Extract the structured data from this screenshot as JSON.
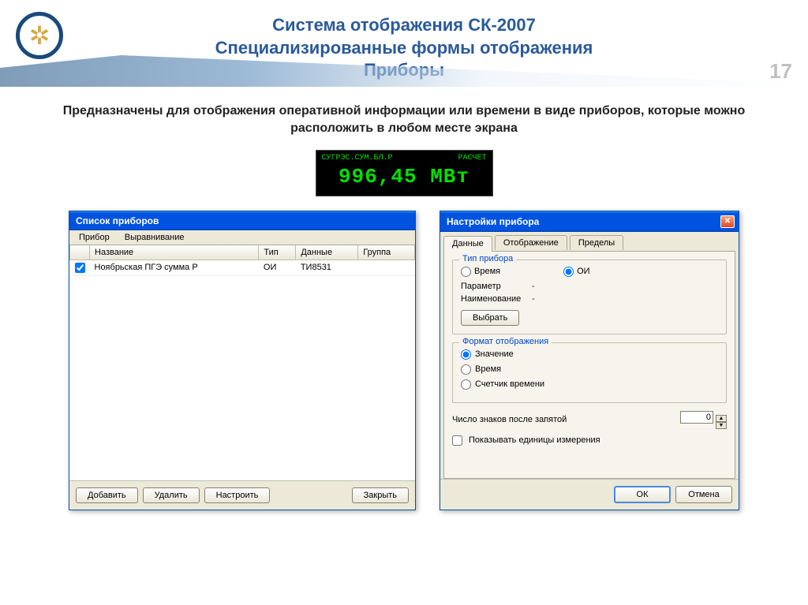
{
  "header": {
    "title1": "Система отображения СК-2007",
    "title2": "Специализированные формы отображения",
    "title3": "Приборы",
    "page_number": "17"
  },
  "description": "Предназначены для отображения оперативной информации или времени в виде приборов, которые можно расположить в любом месте экрана",
  "lcd": {
    "left_label": "СУГРЭС.СУМ.БЛ.Р",
    "right_label": "РАСЧЕТ",
    "value": "996,45 МВт"
  },
  "dialog_list": {
    "title": "Список приборов",
    "menu": {
      "item1": "Прибор",
      "item2": "Выравнивание"
    },
    "columns": {
      "c0": "",
      "c1": "Название",
      "c2": "Тип",
      "c3": "Данные",
      "c4": "Группа"
    },
    "rows": [
      {
        "checked": true,
        "name": "Ноябрьская ПГЭ сумма Р",
        "type": "ОИ",
        "data": "ТИ8531",
        "group": ""
      }
    ],
    "buttons": {
      "add": "Добавить",
      "delete": "Удалить",
      "configure": "Настроить",
      "close": "Закрыть"
    }
  },
  "dialog_settings": {
    "title": "Настройки прибора",
    "tabs": {
      "data": "Данные",
      "display": "Отображение",
      "limits": "Пределы"
    },
    "group_type": {
      "legend": "Тип прибора",
      "opt_time": "Время",
      "opt_oi": "ОИ"
    },
    "param_label": "Параметр",
    "param_value": "-",
    "name_label": "Наименование",
    "name_value": "-",
    "select_btn": "Выбрать",
    "group_format": {
      "legend": "Формат отображения",
      "opt_value": "Значение",
      "opt_time": "Время",
      "opt_counter": "Счетчик времени"
    },
    "decimals_label": "Число знаков после запятой",
    "decimals_value": "0",
    "show_units_label": "Показывать единицы измерения",
    "buttons": {
      "ok": "ОК",
      "cancel": "Отмена"
    }
  }
}
